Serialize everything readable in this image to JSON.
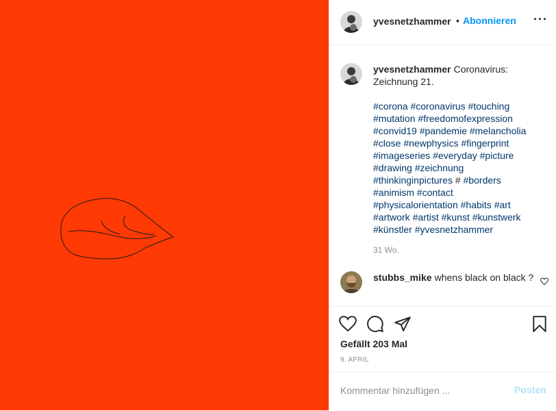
{
  "post": {
    "author": "yvesnetzhammer",
    "follow_dot": "•",
    "follow_label": "Abonnieren",
    "more_label": "···",
    "image_bg_color": "#ff3a04"
  },
  "caption": {
    "username": "yvesnetzhammer",
    "text": "Coronavirus: Zeichnung 21.",
    "hashtags": [
      "#corona",
      "#coronavirus",
      "#touching",
      "#mutation",
      "#freedomofexpression",
      "#convid19",
      "#pandemie",
      "#melancholia",
      "#close",
      "#newphysics",
      "#fingerprint",
      "#imageseries",
      "#everyday",
      "#picture",
      "#drawing",
      "#zeichnung",
      "#thinkinginpictures",
      "#",
      "#borders",
      "#animism",
      "#contact",
      "#physicalorientation",
      "#habits",
      "#art",
      "#artwork",
      "#artist",
      "#kunst",
      "#kunstwerk",
      "#künstler",
      "#yvesnetzhammer"
    ],
    "time": "31 Wo."
  },
  "comment": {
    "username": "stubbs_mike",
    "text": "whens black on black ?"
  },
  "actions": {
    "likes": "Gefällt 203 Mal",
    "date": "9. APRIL",
    "comment_placeholder": "Kommentar hinzufügen ...",
    "post_label": "Posten"
  },
  "colors": {
    "accent": "#0095f6",
    "hashtag": "#00376b",
    "muted": "#8e8e8e",
    "post_disabled": "#b2dffc"
  },
  "icons": [
    "heart-icon",
    "comment-icon",
    "share-icon",
    "bookmark-icon",
    "heart-small-icon",
    "more-icon"
  ]
}
